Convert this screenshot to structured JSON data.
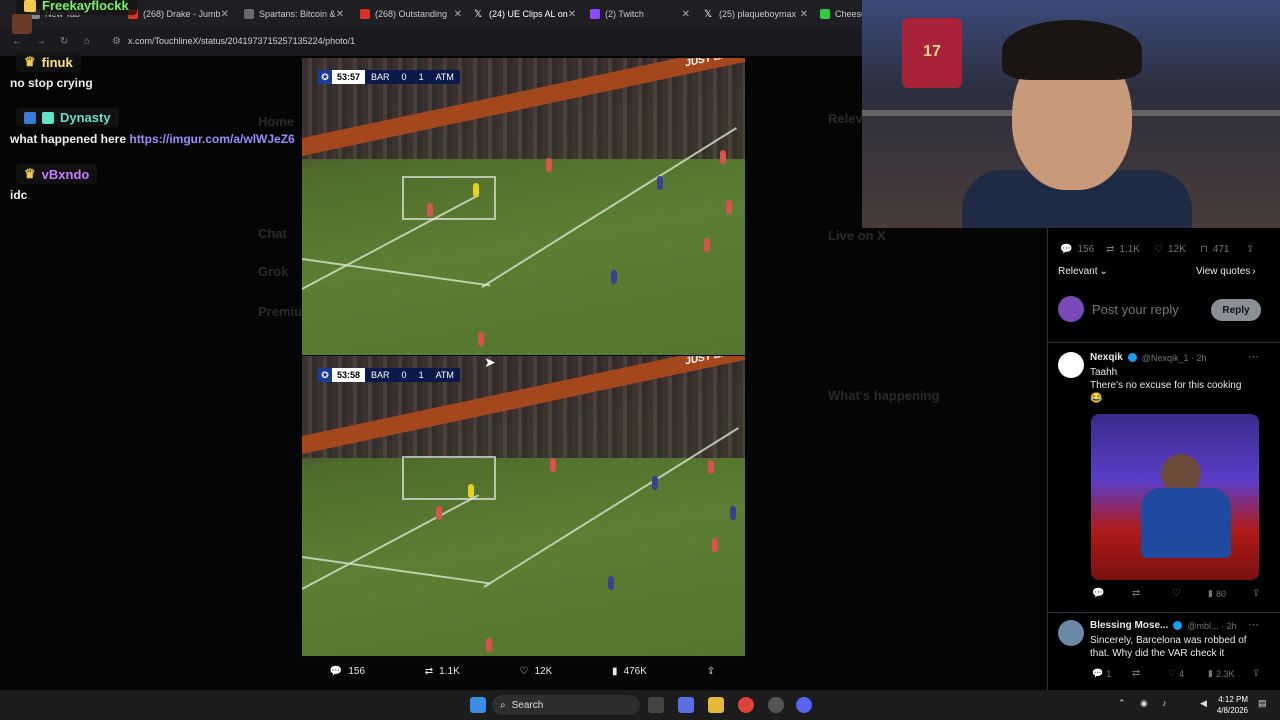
{
  "browser": {
    "tabs": [
      {
        "label": "New Tab",
        "color": "#888888"
      },
      {
        "label": "(268) Drake - Jumb",
        "color": "#d93025"
      },
      {
        "label": "Spartans: Bitcoin &",
        "color": "#6a6a6a"
      },
      {
        "label": "(268) Outstanding",
        "color": "#d93025"
      },
      {
        "label": "(24) UE Clips AL on",
        "color": "#ffffff"
      },
      {
        "label": "(2) Twitch",
        "color": "#9146ff"
      },
      {
        "label": "(25) plaqueboymax",
        "color": "#ffffff"
      },
      {
        "label": "Cheesu",
        "color": "#2ecc40"
      }
    ],
    "url": "x.com/TouchlineX/status/2041973715257135224/photo/1"
  },
  "chat": [
    {
      "user": "Freekayflockk",
      "color": "#7cf06b",
      "text": ""
    },
    {
      "user": "finuk",
      "color": "#ffe27a",
      "text": "no stop crying"
    },
    {
      "user": "Dynasty",
      "color": "#62e2c8",
      "text": "what happened here ",
      "link": "https://imgur.com/a/wlWJeZ6"
    },
    {
      "user": "vBxndo",
      "color": "#c77dff",
      "text": "idc"
    }
  ],
  "media": {
    "frames": [
      {
        "time": "53:57",
        "home": "BAR",
        "home_score": "0",
        "away_score": "1",
        "away": "ATM"
      },
      {
        "time": "53:58",
        "home": "BAR",
        "home_score": "0",
        "away_score": "1",
        "away": "ATM"
      }
    ],
    "ad_text": "JUST EAT",
    "stats": {
      "replies": "156",
      "reposts": "1.1K",
      "likes": "12K",
      "views": "476K"
    }
  },
  "tweet_panel": {
    "stats": {
      "replies": "156",
      "reposts": "1.1K",
      "likes": "12K",
      "bookmarks": "471"
    },
    "sort_label": "Relevant",
    "view_quotes": "View quotes",
    "reply_placeholder": "Post your reply",
    "reply_button": "Reply",
    "replies": [
      {
        "name": "Nexqik",
        "handle": "@Nexqik_1 · 2h",
        "text1": "Taahh",
        "text2": "There's no excuse for this cooking",
        "emoji": "😂",
        "views": "80"
      },
      {
        "name": "Blessing Mose...",
        "handle": "@mbl... · 2h",
        "text1": "Sincerely, Barcelona was robbed of",
        "text2": "that. Why did the VAR check it",
        "replies_count": "1",
        "likes": "4",
        "views": "2.3K"
      }
    ]
  },
  "webcam": {
    "jersey_number": "17"
  },
  "taskbar": {
    "search_label": "Search",
    "time": "4:12 PM",
    "date": "4/8/2026"
  }
}
